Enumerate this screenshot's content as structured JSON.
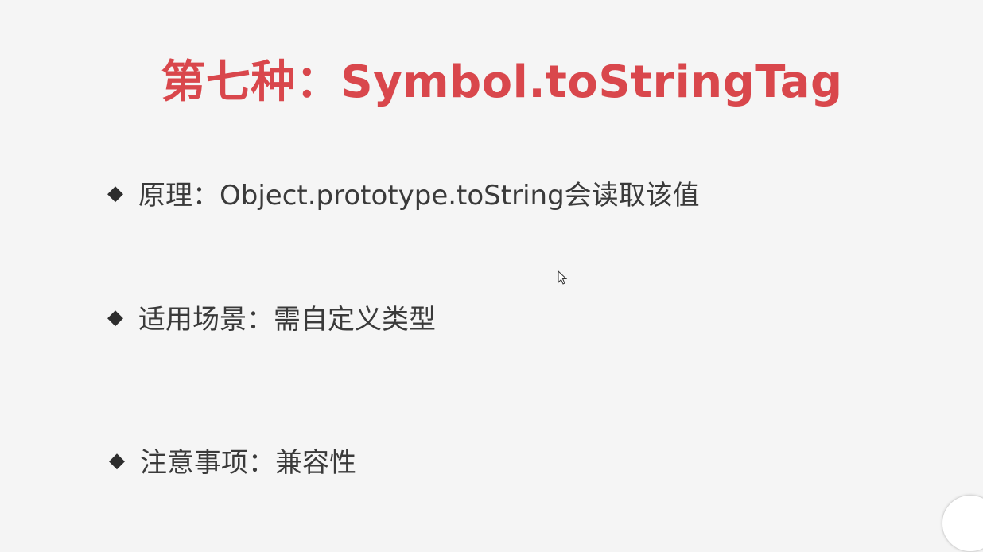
{
  "slide": {
    "title": "第七种：Symbol.toStringTag",
    "bullets": [
      {
        "icon": "diamond-bullet-icon",
        "text": "原理：Object.prototype.toString会读取该值"
      },
      {
        "icon": "diamond-bullet-icon",
        "text": "适用场景：需自定义类型"
      },
      {
        "icon": "diamond-bullet-icon",
        "text": "注意事项：兼容性"
      }
    ],
    "bullet_glyph": "◆"
  },
  "colors": {
    "title": "#d9474c",
    "text": "#3a3a3a",
    "background": "#f5f5f5"
  }
}
